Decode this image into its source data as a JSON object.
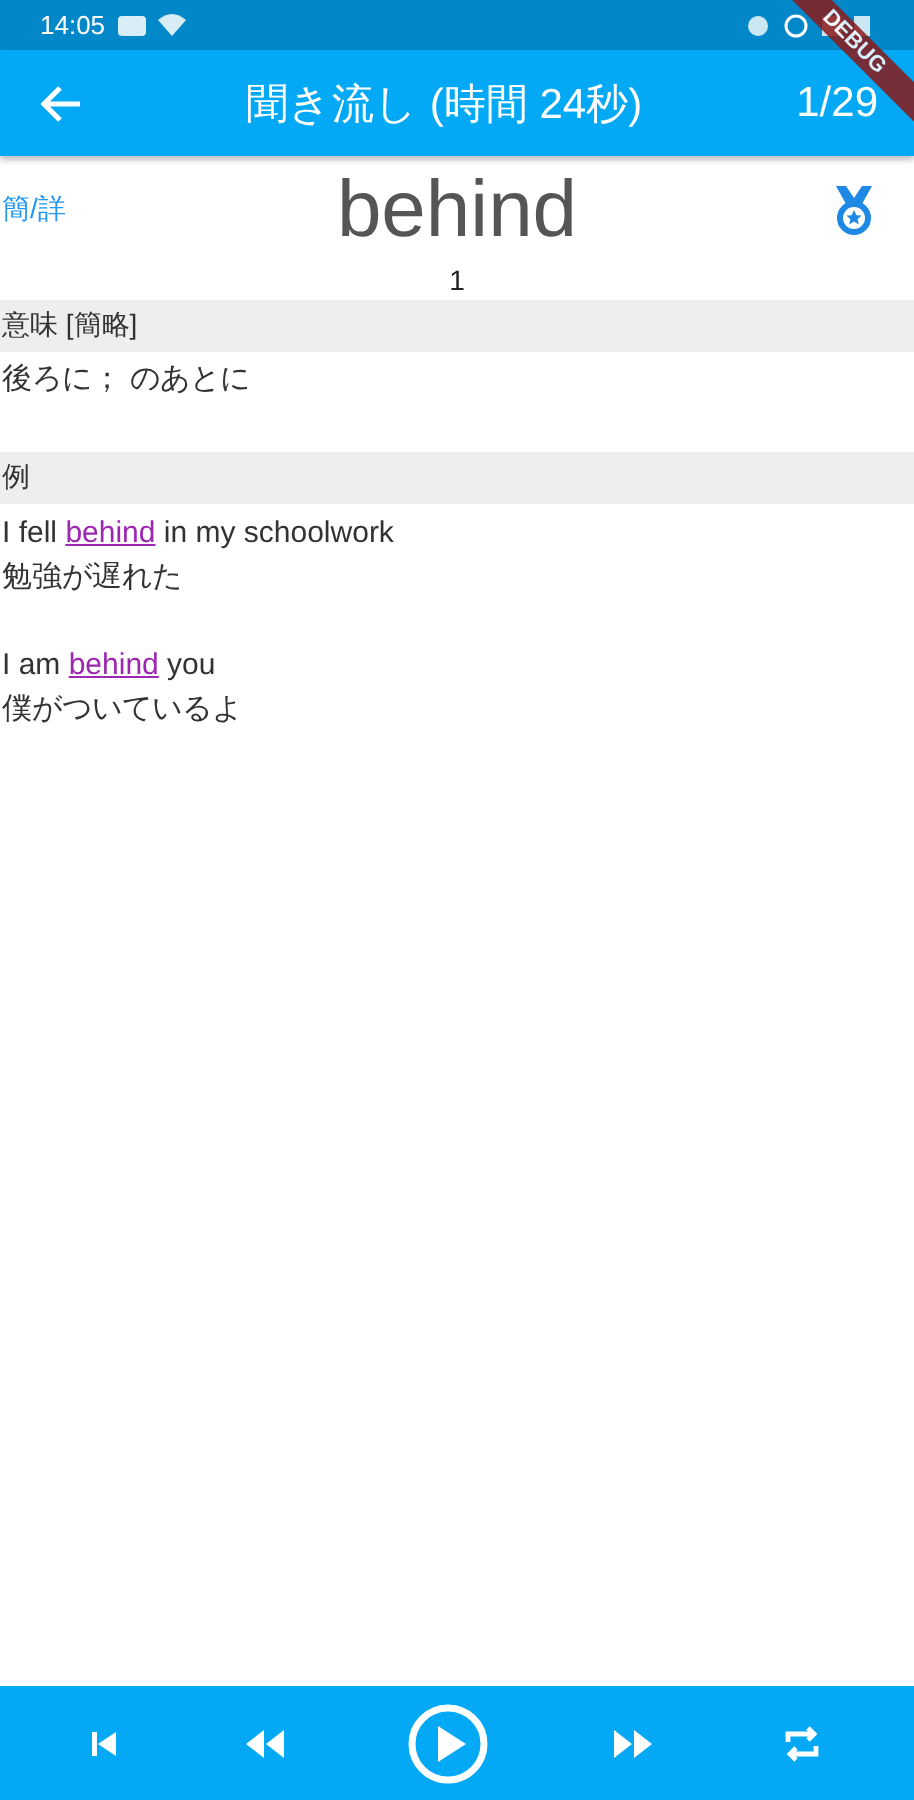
{
  "status_bar": {
    "time": "14:05"
  },
  "debug_banner": "DEBUG",
  "app_bar": {
    "title": "聞き流し (時間 24秒)",
    "counter": "1/29"
  },
  "word": {
    "toggle": "簡/詳",
    "headword": "behind",
    "number": "1"
  },
  "sections": [
    {
      "kind": "meaning",
      "heading": "意味 [簡略]",
      "text": "後ろに； のあとに"
    },
    {
      "kind": "examples",
      "heading": "例",
      "examples": [
        {
          "before": "I fell ",
          "link": "behind",
          "after": " in my schoolwork",
          "translation": "勉強が遅れた"
        },
        {
          "before": "I am ",
          "link": "behind",
          "after": " you",
          "translation": "僕がついているよ"
        }
      ]
    }
  ]
}
